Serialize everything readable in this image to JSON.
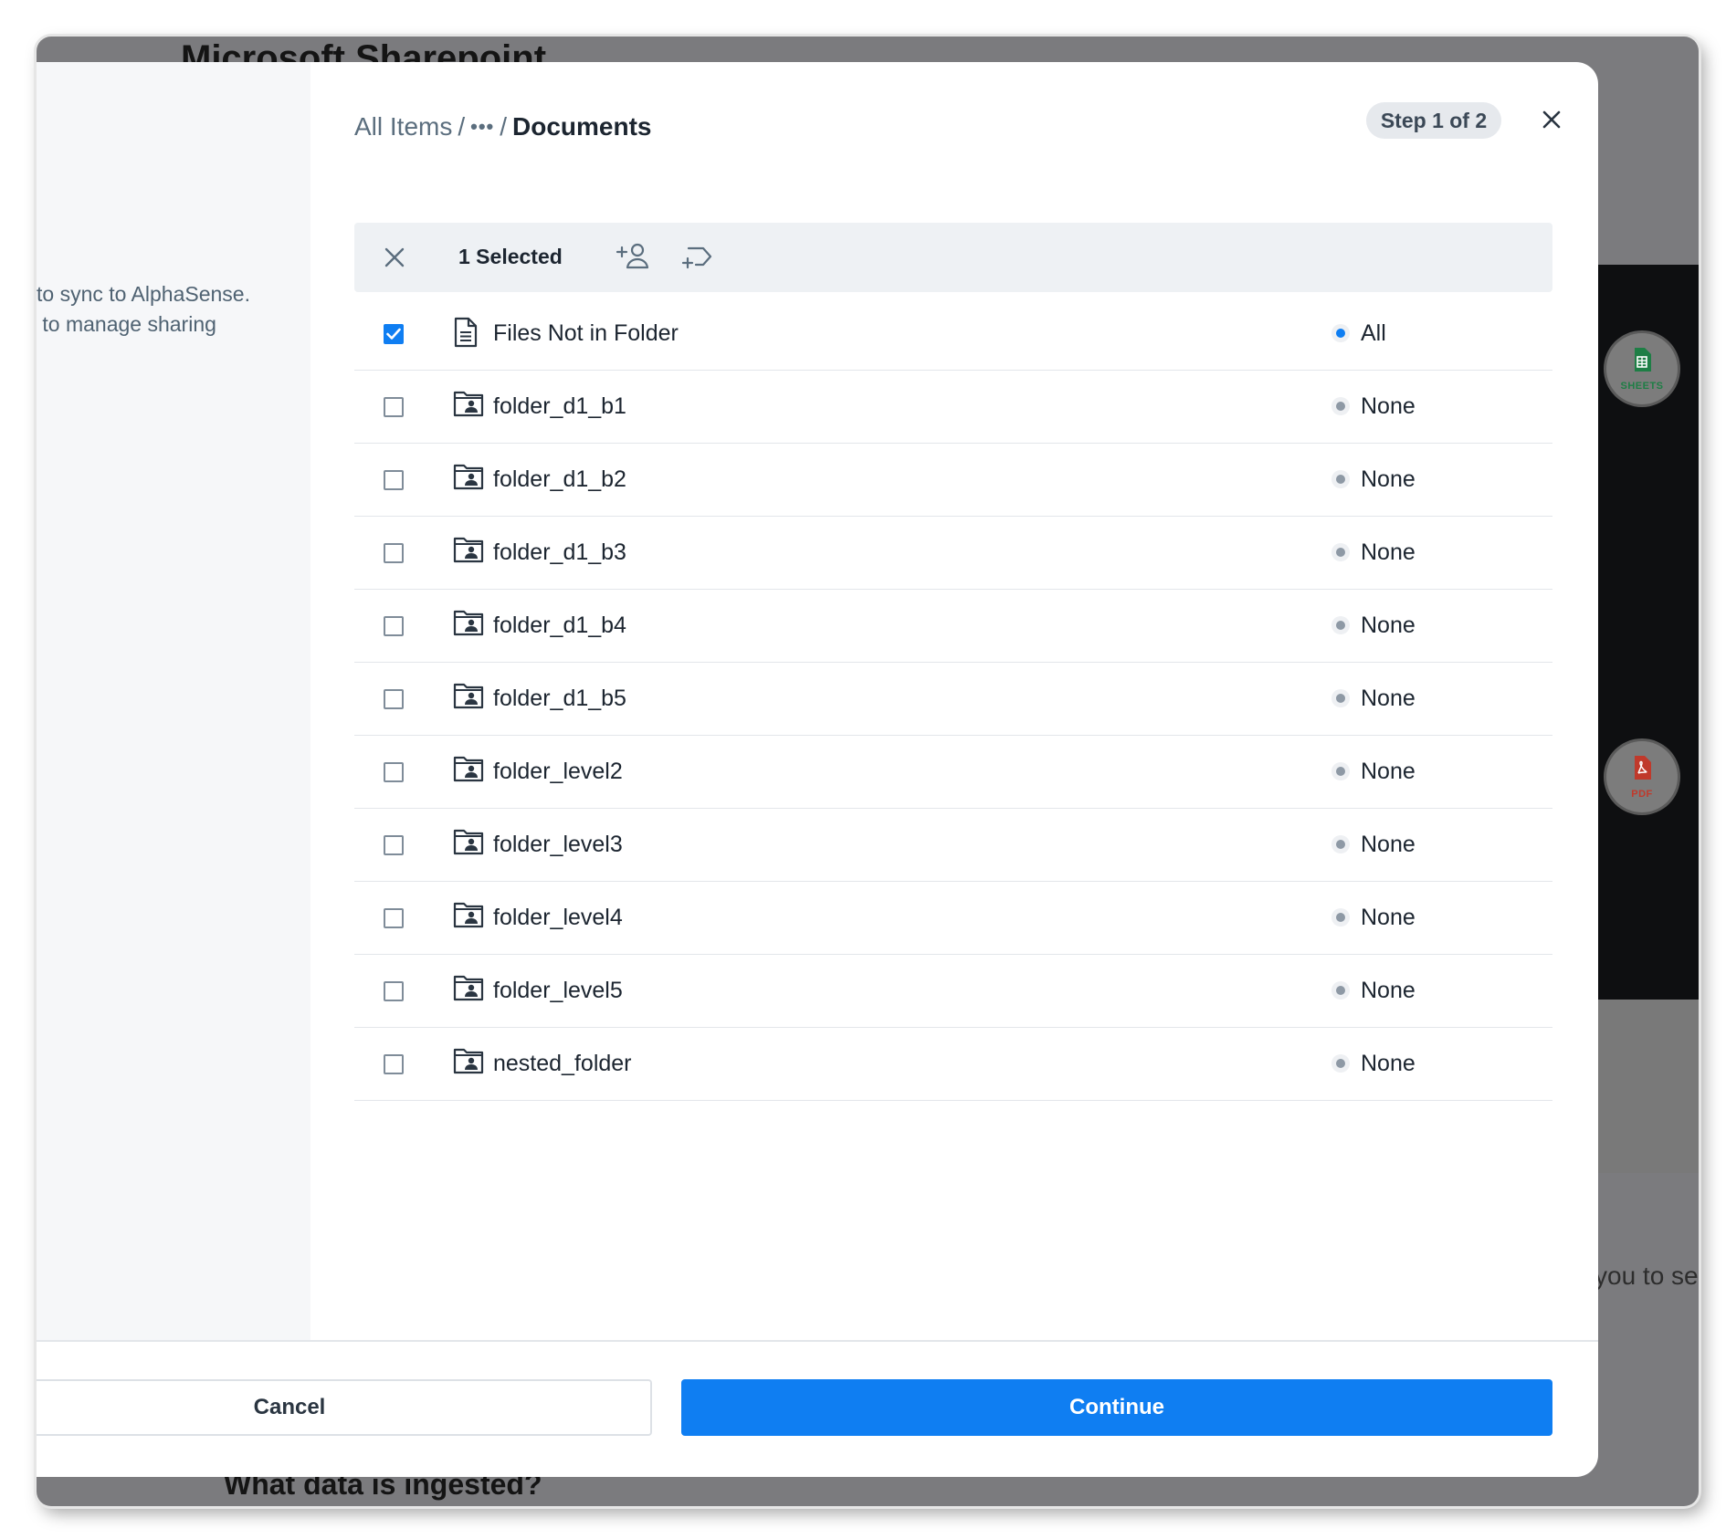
{
  "background": {
    "title": "Microsoft Sharepoint",
    "partial_text": "you to se",
    "section_heading": "What data is ingested?",
    "bubbles": [
      {
        "label": "SHEETS",
        "icon": "sheets-icon",
        "color": "#1e7e45"
      },
      {
        "label": "PDF",
        "icon": "pdf-icon",
        "color": "#c0392b"
      }
    ]
  },
  "sidebar": {
    "line1": "to sync to AlphaSense.",
    "line2": " to manage sharing"
  },
  "breadcrumb": {
    "root": "All Items",
    "separator": "/",
    "ellipsis": "•••",
    "current": "Documents"
  },
  "step_badge": "Step 1 of 2",
  "toolbar": {
    "selected_count": "1 Selected"
  },
  "rows": [
    {
      "name": "Files Not in Folder",
      "type": "file",
      "checked": true,
      "status": "All"
    },
    {
      "name": "folder_d1_b1",
      "type": "folder",
      "checked": false,
      "status": "None"
    },
    {
      "name": "folder_d1_b2",
      "type": "folder",
      "checked": false,
      "status": "None"
    },
    {
      "name": "folder_d1_b3",
      "type": "folder",
      "checked": false,
      "status": "None"
    },
    {
      "name": "folder_d1_b4",
      "type": "folder",
      "checked": false,
      "status": "None"
    },
    {
      "name": "folder_d1_b5",
      "type": "folder",
      "checked": false,
      "status": "None"
    },
    {
      "name": "folder_level2",
      "type": "folder",
      "checked": false,
      "status": "None"
    },
    {
      "name": "folder_level3",
      "type": "folder",
      "checked": false,
      "status": "None"
    },
    {
      "name": "folder_level4",
      "type": "folder",
      "checked": false,
      "status": "None"
    },
    {
      "name": "folder_level5",
      "type": "folder",
      "checked": false,
      "status": "None"
    },
    {
      "name": "nested_folder",
      "type": "folder",
      "checked": false,
      "status": "None"
    }
  ],
  "footer": {
    "cancel_label": "Cancel",
    "continue_label": "Continue"
  },
  "colors": {
    "accent": "#0f7ef2",
    "text": "#1c2530",
    "muted": "#5b6e7e"
  }
}
